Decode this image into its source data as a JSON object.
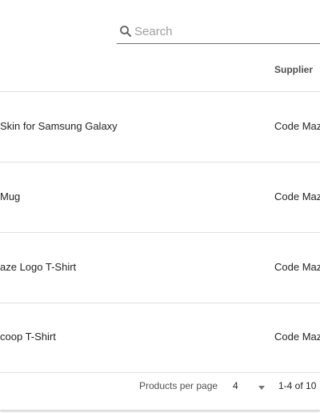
{
  "search": {
    "placeholder": "Search",
    "value": ""
  },
  "table": {
    "headers": {
      "supplier": "Supplier"
    },
    "rows": [
      {
        "name": "Skin for Samsung Galaxy",
        "supplier": "Code Maz"
      },
      {
        "name": "Mug",
        "supplier": "Code Maz"
      },
      {
        "name": "aze Logo T-Shirt",
        "supplier": "Code Maz"
      },
      {
        "name": "coop T-Shirt",
        "supplier": "Code Maz"
      }
    ]
  },
  "paginator": {
    "label": "Products per page",
    "page_size": "4",
    "range": "1-4 of 10"
  },
  "colors": {
    "accent": "#5c6bc0",
    "divider": "#e0e0e0"
  },
  "icons": {
    "search": "search-icon",
    "dropdown": "chevron-down-icon"
  }
}
